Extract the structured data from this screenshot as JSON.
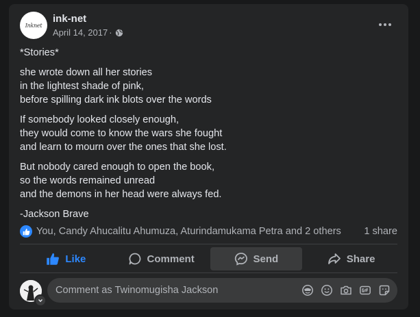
{
  "post": {
    "page_name": "ink-net",
    "avatar_logo_text": "Inknet",
    "date": "April 14, 2017",
    "separator": "·",
    "privacy_icon": "globe-icon",
    "paragraphs": [
      [
        "*Stories*"
      ],
      [
        "she wrote down all her stories",
        "in the lightest shade of pink,",
        "before spilling dark ink blots over the words"
      ],
      [
        "If somebody looked closely enough,",
        "they would come to know the wars she fought",
        "and learn to mourn over the ones that she lost."
      ],
      [
        "But nobody cared enough to open the book,",
        "so the words remained unread",
        "and the demons in her head were always fed."
      ],
      [
        "-Jackson Brave"
      ]
    ]
  },
  "reactions": {
    "summary": "You, Candy Ahucalitu Ahumuza, Aturindamukama Petra and 2 others",
    "shares": "1 share"
  },
  "actions": {
    "like": "Like",
    "comment": "Comment",
    "send": "Send",
    "share": "Share"
  },
  "comment": {
    "placeholder": "Comment as Twinomugisha Jackson",
    "tools": [
      "avatar-sticker-icon",
      "emoji-icon",
      "camera-icon",
      "gif-icon",
      "sticker-icon"
    ]
  },
  "colors": {
    "background": "#18191a",
    "card": "#242526",
    "accent": "#2d88ff",
    "text_primary": "#e4e6eb",
    "text_secondary": "#b0b3b8"
  }
}
